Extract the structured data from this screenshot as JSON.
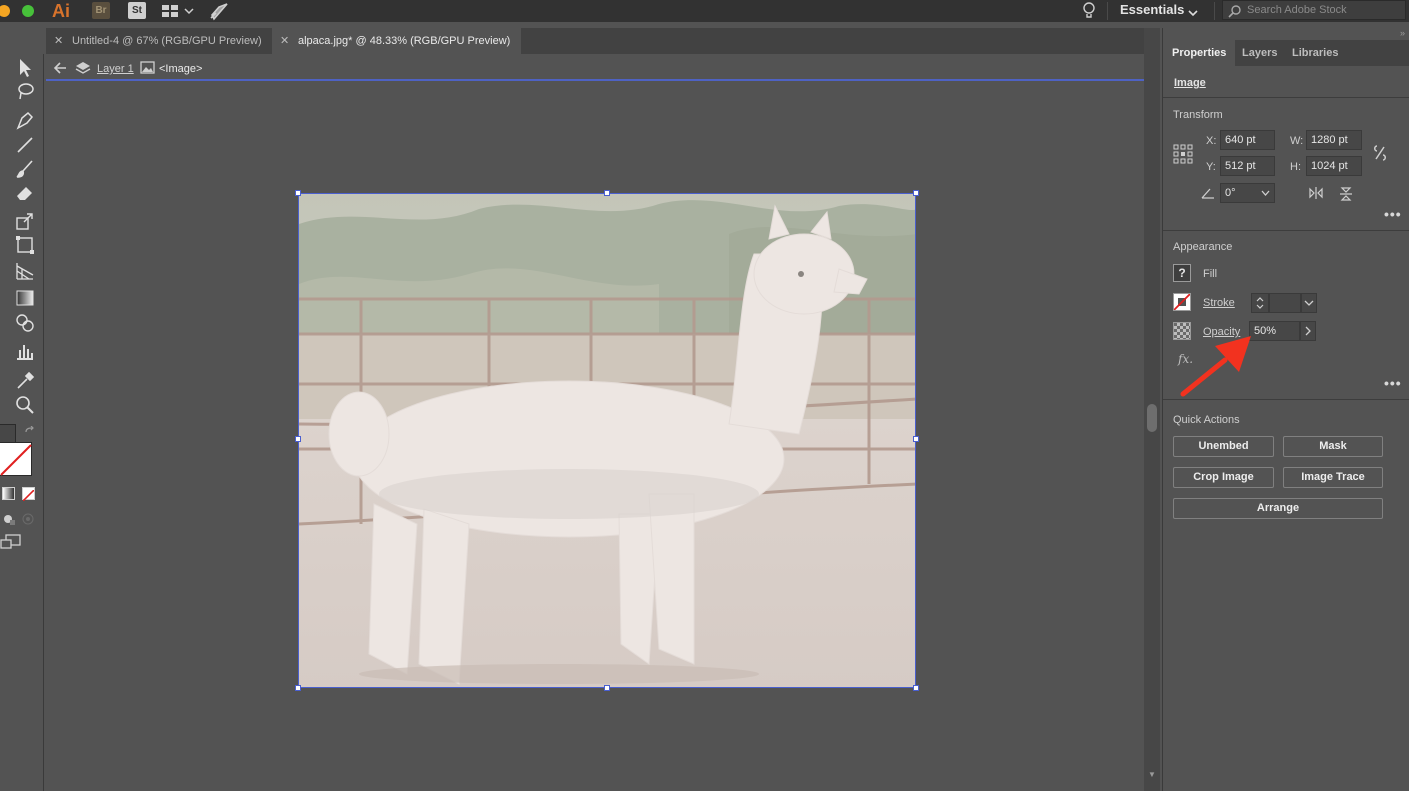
{
  "app": {
    "logo": "Ai",
    "bridge": "Br",
    "stock": "St",
    "workspace": "Essentials",
    "search_placeholder": "Search Adobe Stock"
  },
  "tabs": [
    {
      "label": "Untitled-4 @ 67% (RGB/GPU Preview)",
      "active": false
    },
    {
      "label": "alpaca.jpg* @ 48.33% (RGB/GPU Preview)",
      "active": true
    }
  ],
  "breadcrumb": {
    "layer": "Layer 1",
    "object": "<Image>"
  },
  "panel": {
    "tabs": [
      "Properties",
      "Layers",
      "Libraries"
    ],
    "selection": "Image",
    "transform": {
      "title": "Transform",
      "x_label": "X:",
      "x": "640 pt",
      "y_label": "Y:",
      "y": "512 pt",
      "w_label": "W:",
      "w": "1280 pt",
      "h_label": "H:",
      "h": "1024 pt",
      "rotate": "0°"
    },
    "appearance": {
      "title": "Appearance",
      "fill": "Fill",
      "stroke": "Stroke",
      "opacity_label": "Opacity",
      "opacity": "50%",
      "fx": "fx."
    },
    "quick_actions": {
      "title": "Quick Actions",
      "unembed": "Unembed",
      "mask": "Mask",
      "crop": "Crop Image",
      "trace": "Image Trace",
      "arrange": "Arrange"
    }
  },
  "colors": {
    "accent": "#4a5fcf",
    "annotation_arrow": "#f2321f",
    "logo": "#d7732c"
  },
  "image_subject": "white alpaca in front of a metal fence, shown at 50% opacity"
}
